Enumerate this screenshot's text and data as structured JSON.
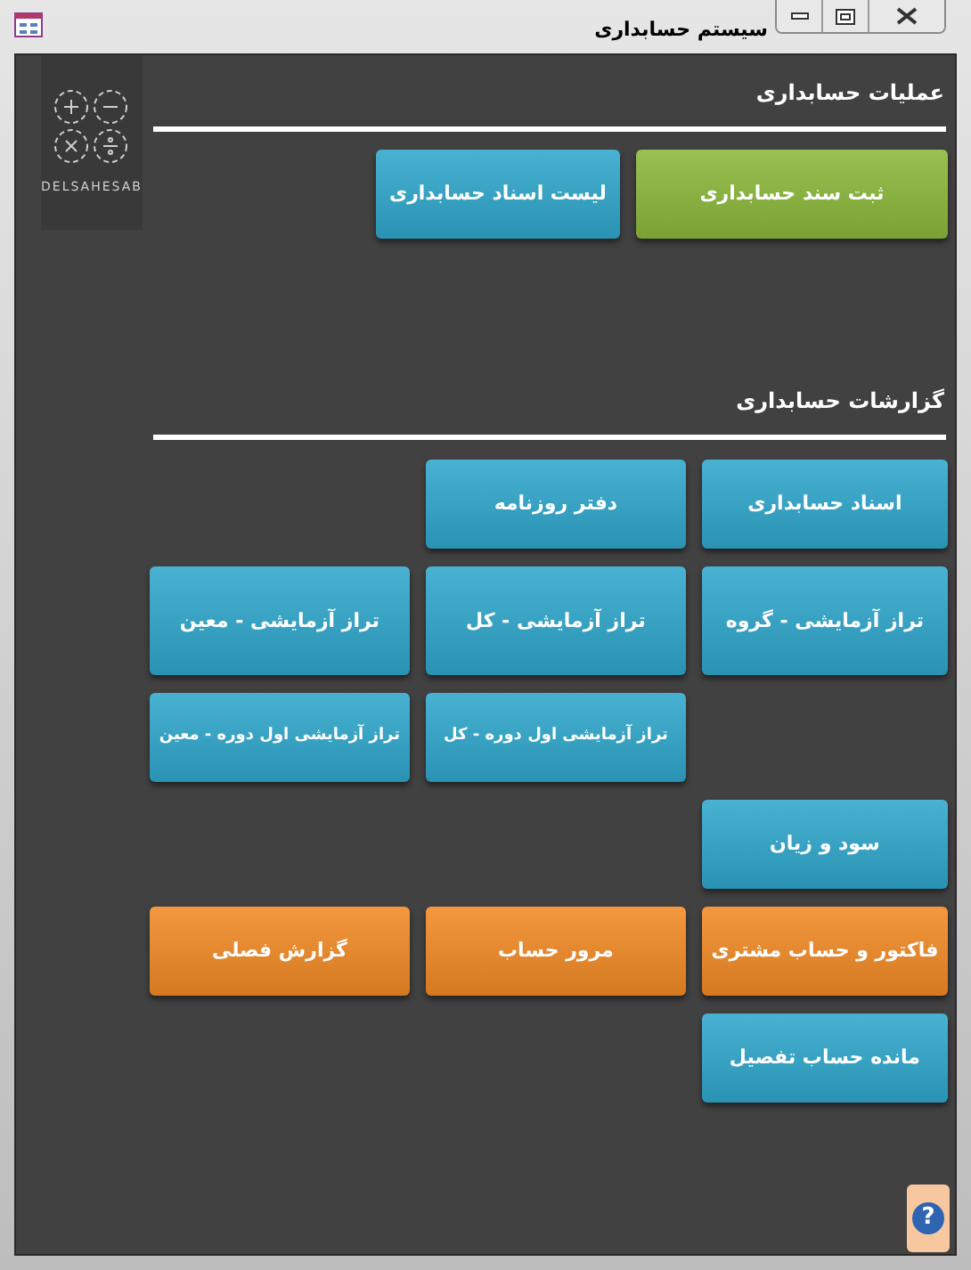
{
  "window": {
    "title": "سیستم حسابداری"
  },
  "logo": {
    "text": "DELSAHESAB"
  },
  "operations": {
    "heading": "عملیات حسابداری",
    "buttons": [
      {
        "label": "ثبت سند حسابداری",
        "color": "#8ab83a"
      },
      {
        "label": "لیست اسناد حسابداری",
        "color": "#2fa7cc"
      }
    ]
  },
  "reports": {
    "heading": "گزارشات حسابداری",
    "rows": [
      {
        "buttons": [
          {
            "label": "اسناد حسابداری",
            "color": "#2fa7cc"
          },
          {
            "label": "دفتر روزنامه",
            "color": "#2fa7cc"
          }
        ]
      },
      {
        "buttons": [
          {
            "label": "تراز آزمایشی - گروه",
            "color": "#2fa7cc"
          },
          {
            "label": "تراز آزمایشی - کل",
            "color": "#2fa7cc"
          },
          {
            "label": "تراز آزمایشی - معین",
            "color": "#2fa7cc"
          }
        ]
      },
      {
        "buttons": [
          {
            "kind": "spacer"
          },
          {
            "kind": "button",
            "label": "تراز آزمایشی اول دوره - کل",
            "color": "#2fa7cc",
            "small": true
          },
          {
            "kind": "button",
            "label": "تراز آزمایشی اول دوره - معین",
            "color": "#2fa7cc",
            "small": true
          }
        ]
      },
      {
        "buttons": [
          {
            "label": "سود و زیان",
            "color": "#2fa7cc"
          }
        ]
      },
      {
        "buttons": [
          {
            "label": "فاکتور و حساب مشتری",
            "color": "#f28a24"
          },
          {
            "label": "مرور حساب",
            "color": "#f28a24"
          },
          {
            "label": "گزارش فصلی",
            "color": "#f28a24"
          }
        ]
      },
      {
        "buttons": [
          {
            "label": "مانده حساب تفصیل",
            "color": "#2fa7cc"
          }
        ]
      }
    ]
  },
  "help": {
    "label": "?"
  }
}
